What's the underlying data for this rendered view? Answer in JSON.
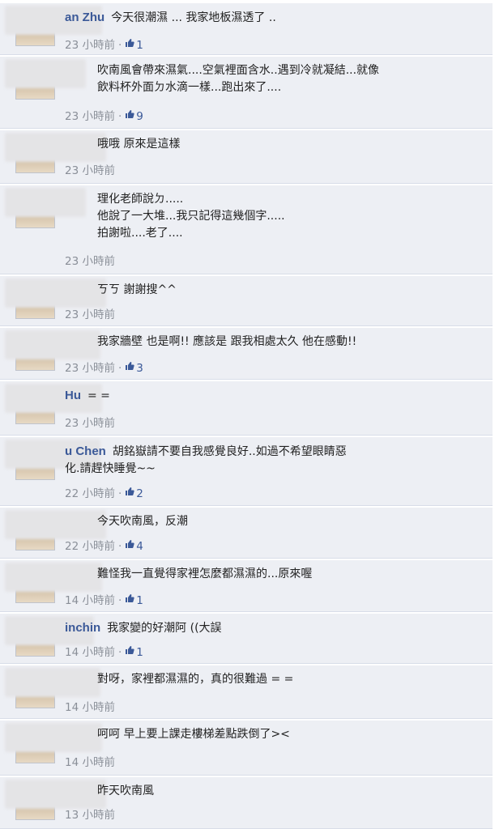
{
  "comments": [
    {
      "name": "an Zhu",
      "text": "今天很潮濕 ... 我家地板濕透了 ..",
      "time": "23 小時前",
      "likes": "1"
    },
    {
      "name": "",
      "text": "吹南風會帶來濕氣....空氣裡面含水..遇到冷就凝結...就像\n飲料杯外面ㄉ水滴一樣...跑出來了....",
      "time": "23 小時前",
      "likes": "9"
    },
    {
      "name": "",
      "text": "哦哦 原來是這樣",
      "time": "23 小時前",
      "likes": ""
    },
    {
      "name": "",
      "text": "理化老師說ㄉ.....\n他說了一大堆...我只記得這幾個字.....\n拍謝啦....老了....",
      "time": "23 小時前",
      "likes": ""
    },
    {
      "name": "",
      "text": "ㄎㄎ 謝謝搜^^",
      "time": "23 小時前",
      "likes": ""
    },
    {
      "name": "",
      "text": "我家牆壁 也是啊!! 應該是 跟我相處太久 他在感動!!",
      "time": "23 小時前",
      "likes": "3"
    },
    {
      "name": "Hu",
      "text": "= =",
      "time": "23 小時前",
      "likes": ""
    },
    {
      "name": "u Chen",
      "text": "胡銘嶽請不要自我感覺良好..如過不希望眼睛惡\n化.請趕快睡覺~~",
      "time": "22 小時前",
      "likes": "2"
    },
    {
      "name": "",
      "text": "今天吹南風，反潮",
      "time": "22 小時前",
      "likes": "4"
    },
    {
      "name": "",
      "text": "難怪我一直覺得家裡怎麼都濕濕的...原來喔",
      "time": "14 小時前",
      "likes": "1"
    },
    {
      "name": "inchin",
      "text": "我家變的好潮阿 ((大誤",
      "time": "14 小時前",
      "likes": "1"
    },
    {
      "name": "",
      "text": "對呀，家裡都濕濕的，真的很難過 = =",
      "time": "14 小時前",
      "likes": ""
    },
    {
      "name": "",
      "text": "呵呵 早上要上課走樓梯差點跌倒了><",
      "time": "14 小時前",
      "likes": ""
    },
    {
      "name": "",
      "text": "昨天吹南風",
      "time": "13 小時前",
      "likes": ""
    }
  ]
}
